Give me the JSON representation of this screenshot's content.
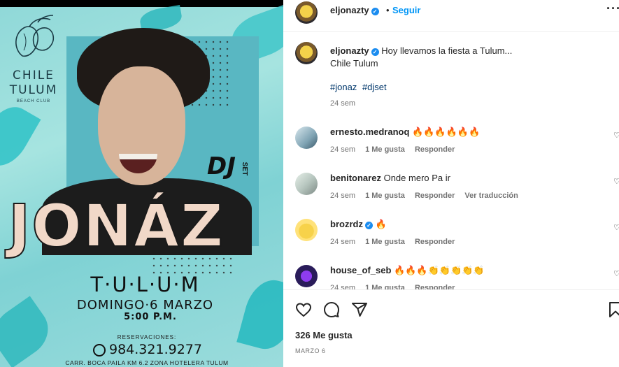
{
  "poster": {
    "brand_line1": "CHILE",
    "brand_line2": "TULUM",
    "brand_sub": "BEACH CLUB",
    "dj": "DJ",
    "dj_set": "SET",
    "artist": "JONÁZ",
    "city": "T·U·L·U·M",
    "date": "DOMINGO·6 MARZO",
    "time": "5:00 P.M.",
    "reservations_label": "RESERVACIONES:",
    "phone": "984.321.9277",
    "address": "CARR. BOCA PAILA KM 6.2 ZONA HOTELERA TULUM"
  },
  "header": {
    "username": "eljonazty",
    "separator": "•",
    "follow_label": "Seguir",
    "more_label": "···"
  },
  "caption": {
    "username": "eljonazty",
    "text_line1": "Hoy llevamos la fiesta a Tulum...",
    "text_line2": "Chile Tulum",
    "tags": [
      "#jonaz",
      "#djset"
    ],
    "time_ago": "24 sem"
  },
  "comments": [
    {
      "username": "ernesto.medranoq",
      "text": "🔥🔥🔥🔥🔥🔥",
      "time_ago": "24 sem",
      "likes": "1 Me gusta",
      "reply": "Responder",
      "translate": ""
    },
    {
      "username": "benitonarez",
      "text": "Onde mero Pa ir",
      "time_ago": "24 sem",
      "likes": "1 Me gusta",
      "reply": "Responder",
      "translate": "Ver traducción"
    },
    {
      "username": "brozrdz",
      "text": "🔥",
      "time_ago": "24 sem",
      "likes": "1 Me gusta",
      "reply": "Responder",
      "translate": ""
    },
    {
      "username": "house_of_seb",
      "text": "🔥🔥🔥👏👏👏👏👏",
      "time_ago": "24 sem",
      "likes": "1 Me gusta",
      "reply": "Responder",
      "translate": ""
    }
  ],
  "actions": {
    "likes_label": "326 Me gusta",
    "post_date": "MARZO 6"
  },
  "colors": {
    "link_blue": "#0095f6",
    "hashtag_blue": "#00376b",
    "verified_blue": "#1a8cf0",
    "meta_gray": "#737373",
    "poster_teal": "#8fd8d8"
  }
}
